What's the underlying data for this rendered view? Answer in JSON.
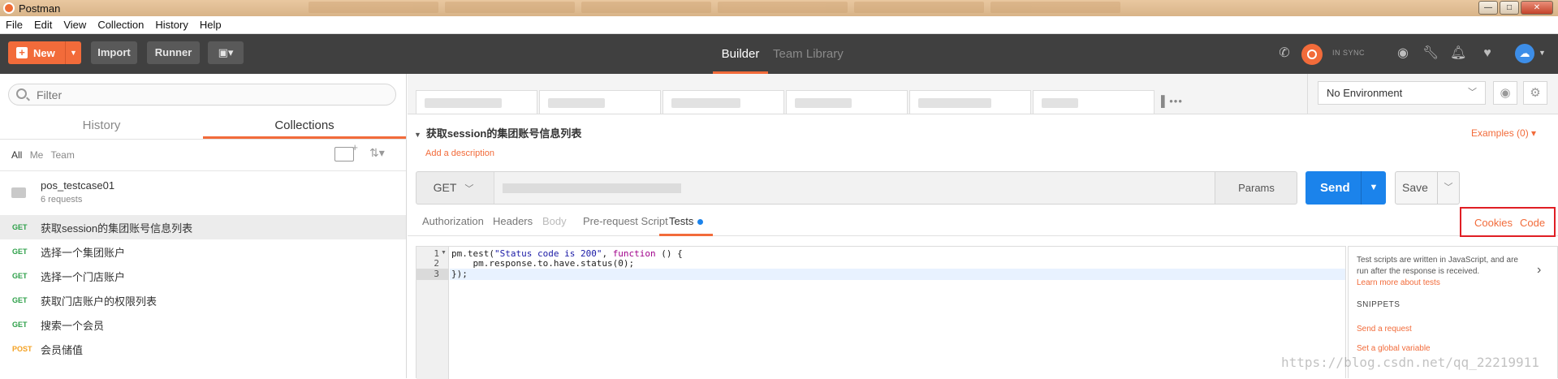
{
  "window": {
    "title": "Postman",
    "buttons": {
      "minimize": "—",
      "maximize": "□",
      "close": "✕"
    }
  },
  "menu": [
    "File",
    "Edit",
    "View",
    "Collection",
    "History",
    "Help"
  ],
  "header": {
    "new_label": "New",
    "import_label": "Import",
    "runner_label": "Runner",
    "builder_label": "Builder",
    "team_library_label": "Team Library",
    "sync_label": "IN SYNC",
    "accent": "#f26b3a"
  },
  "sidebar": {
    "filter_placeholder": "Filter",
    "tabs": [
      "History",
      "Collections"
    ],
    "active_tab": "Collections",
    "filters": [
      "All",
      "Me",
      "Team"
    ],
    "collection": {
      "name": "pos_testcase01",
      "count": "6 requests"
    },
    "requests": [
      {
        "method": "GET",
        "name": "获取session的集团账号信息列表",
        "active": true
      },
      {
        "method": "GET",
        "name": "选择一个集团账户"
      },
      {
        "method": "GET",
        "name": "选择一个门店账户"
      },
      {
        "method": "GET",
        "name": "获取门店账户的权限列表"
      },
      {
        "method": "GET",
        "name": "搜索一个会员"
      },
      {
        "method": "POST",
        "name": "会员储值"
      }
    ]
  },
  "environment": {
    "selected": "No Environment"
  },
  "request": {
    "title": "获取session的集团账号信息列表",
    "add_description": "Add a description",
    "examples": "Examples (0)",
    "method": "GET",
    "params_label": "Params",
    "send_label": "Send",
    "save_label": "Save"
  },
  "body_tabs": [
    "Authorization",
    "Headers",
    "Body",
    "Pre-request Script",
    "Tests"
  ],
  "active_body_tab": "Tests",
  "cookies_label": "Cookies",
  "code_label": "Code",
  "editor": {
    "line_numbers": [
      "1",
      "2",
      "3"
    ],
    "lines": [
      {
        "pre": "pm.test(",
        "str": "\"Status code is 200\"",
        "mid": ", ",
        "kw": "function",
        "post": " () {"
      },
      {
        "text": "    pm.response.to.have.status(0);"
      },
      {
        "text": "});"
      }
    ]
  },
  "snippets": {
    "description": "Test scripts are written in JavaScript, and are run after the response is received.",
    "learn_more": "Learn more about tests",
    "heading": "SNIPPETS",
    "items": [
      "Send a request",
      "Set a global variable"
    ]
  },
  "watermark": "https://blog.csdn.net/qq_22219911"
}
